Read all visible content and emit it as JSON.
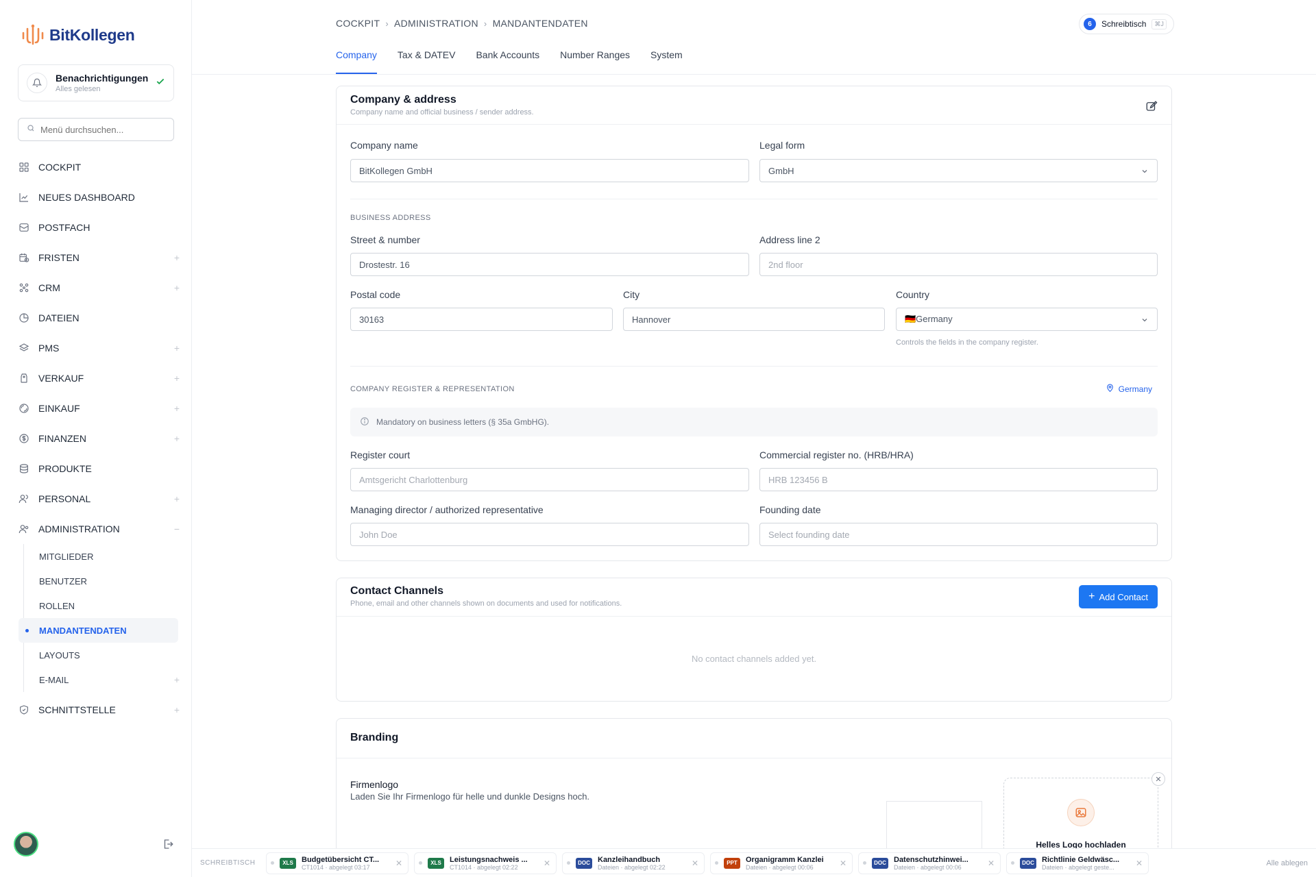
{
  "app": {
    "name": "BitKollegen"
  },
  "notifications": {
    "title": "Benachrichtigungen",
    "status": "Alles gelesen"
  },
  "menu_search": {
    "placeholder": "Menü durchsuchen..."
  },
  "nav": {
    "items": [
      {
        "label": "COCKPIT",
        "icon": "grid-icon",
        "expandable": false
      },
      {
        "label": "NEUES DASHBOARD",
        "icon": "chart-line-icon",
        "expandable": false
      },
      {
        "label": "POSTFACH",
        "icon": "mailbox-icon",
        "expandable": false
      },
      {
        "label": "FRISTEN",
        "icon": "calendar-clock-icon",
        "expandable": true
      },
      {
        "label": "CRM",
        "icon": "network-icon",
        "expandable": true
      },
      {
        "label": "DATEIEN",
        "icon": "pie-icon",
        "expandable": false
      },
      {
        "label": "PMS",
        "icon": "layers-icon",
        "expandable": true
      },
      {
        "label": "VERKAUF",
        "icon": "tag-icon",
        "expandable": true
      },
      {
        "label": "EINKAUF",
        "icon": "cart-icon",
        "expandable": true
      },
      {
        "label": "FINANZEN",
        "icon": "dollar-icon",
        "expandable": true
      },
      {
        "label": "PRODUKTE",
        "icon": "stack-icon",
        "expandable": false
      },
      {
        "label": "PERSONAL",
        "icon": "users-icon",
        "expandable": true
      }
    ],
    "admin": {
      "label": "ADMINISTRATION",
      "sub": [
        "MITGLIEDER",
        "BENUTZER",
        "ROLLEN",
        "MANDANTENDATEN",
        "LAYOUTS",
        "E-MAIL"
      ],
      "active": "MANDANTENDATEN"
    },
    "last": {
      "label": "SCHNITTSTELLE"
    }
  },
  "breadcrumb": [
    "COCKPIT",
    "ADMINISTRATION",
    "MANDANTENDATEN"
  ],
  "desk": {
    "count": "6",
    "label": "Schreibtisch",
    "shortcut": "⌘J"
  },
  "tabs": [
    "Company",
    "Tax & DATEV",
    "Bank Accounts",
    "Number Ranges",
    "System"
  ],
  "company": {
    "title": "Company & address",
    "subtitle": "Company name and official business / sender address.",
    "name_label": "Company name",
    "name_value": "BitKollegen GmbH",
    "legal_label": "Legal form",
    "legal_value": "GmbH",
    "business_address": "BUSINESS ADDRESS",
    "street_label": "Street & number",
    "street_value": "Drostestr. 16",
    "addr2_label": "Address line 2",
    "addr2_placeholder": "2nd floor",
    "postal_label": "Postal code",
    "postal_value": "30163",
    "city_label": "City",
    "city_value": "Hannover",
    "country_label": "Country",
    "country_value": "🇩🇪Germany",
    "country_hint": "Controls the fields in the company register.",
    "register_section": "COMPANY REGISTER & REPRESENTATION",
    "register_country": "Germany",
    "register_info": "Mandatory on business letters (§ 35a GmbHG).",
    "court_label": "Register court",
    "court_placeholder": "Amtsgericht Charlottenburg",
    "regno_label": "Commercial register no. (HRB/HRA)",
    "regno_placeholder": "HRB 123456 B",
    "director_label": "Managing director / authorized representative",
    "director_placeholder": "John Doe",
    "founding_label": "Founding date",
    "founding_placeholder": "Select founding date"
  },
  "contacts": {
    "title": "Contact Channels",
    "subtitle": "Phone, email and other channels shown on documents and used for notifications.",
    "add_label": "Add Contact",
    "empty": "No contact channels added yet."
  },
  "branding": {
    "title": "Branding",
    "logo_title": "Firmenlogo",
    "logo_desc": "Laden Sie Ihr Firmenlogo für helle und dunkle Designs hoch.",
    "upload_light": "Helles Logo hochladen"
  },
  "bottombar": {
    "label": "SCHREIBTISCH",
    "docs": [
      {
        "type": "XLS",
        "color": "#1f7a4a",
        "name": "Budgetübersicht CT...",
        "meta": "CT1014 · abgelegt 03:17"
      },
      {
        "type": "XLS",
        "color": "#1f7a4a",
        "name": "Leistungsnachweis ...",
        "meta": "CT1014 · abgelegt 02:22"
      },
      {
        "type": "DOC",
        "color": "#2b4c9b",
        "name": "Kanzleihandbuch",
        "meta": "Dateien · abgelegt 02:22"
      },
      {
        "type": "PPT",
        "color": "#c2410c",
        "name": "Organigramm Kanzlei",
        "meta": "Dateien · abgelegt 00:06"
      },
      {
        "type": "DOC",
        "color": "#2b4c9b",
        "name": "Datenschutzhinwei...",
        "meta": "Dateien · abgelegt 00:06"
      },
      {
        "type": "DOC",
        "color": "#2b4c9b",
        "name": "Richtlinie Geldwäsc...",
        "meta": "Dateien · abgelegt geste..."
      }
    ],
    "right": "Alle ablegen"
  }
}
